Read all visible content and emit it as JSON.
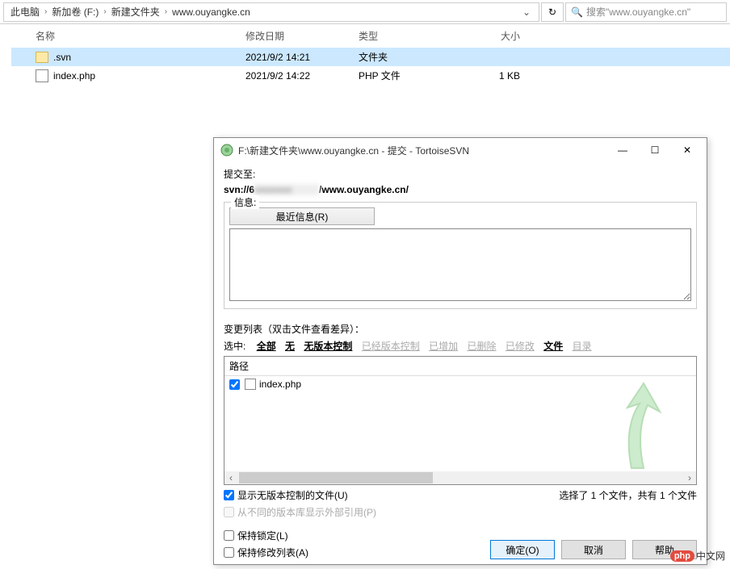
{
  "explorer": {
    "breadcrumb": [
      "此电脑",
      "新加卷 (F:)",
      "新建文件夹",
      "www.ouyangke.cn"
    ],
    "search_placeholder": "搜索\"www.ouyangke.cn\"",
    "columns": {
      "name": "名称",
      "date": "修改日期",
      "type": "类型",
      "size": "大小"
    },
    "rows": [
      {
        "name": ".svn",
        "date": "2021/9/2 14:21",
        "type": "文件夹",
        "size": "",
        "icon": "folder",
        "selected": true
      },
      {
        "name": "index.php",
        "date": "2021/9/2 14:22",
        "type": "PHP 文件",
        "size": "1 KB",
        "icon": "php",
        "selected": false
      }
    ]
  },
  "dialog": {
    "title": "F:\\新建文件夹\\www.ouyangke.cn - 提交 - TortoiseSVN",
    "commit_to_label": "提交至:",
    "url_prefix": "svn://6",
    "url_suffix": "/www.ouyangke.cn/",
    "info_label": "信息:",
    "recent_btn": "最近信息(R)",
    "changes_label": "变更列表（双击文件查看差异）：",
    "filter_label": "选中:",
    "filters": {
      "all": "全部",
      "none": "无",
      "unversioned": "无版本控制",
      "versioned": "已经版本控制",
      "added": "已增加",
      "deleted": "已删除",
      "modified": "已修改",
      "files": "文件",
      "dirs": "目录"
    },
    "list_header": "路径",
    "list_items": [
      {
        "checked": true,
        "name": "index.php"
      }
    ],
    "show_unversioned": "显示无版本控制的文件(U)",
    "show_externals": "从不同的版本库显示外部引用(P)",
    "selection_status": "选择了 1 个文件，共有 1 个文件",
    "keep_locks": "保持锁定(L)",
    "keep_changelist": "保持修改列表(A)",
    "ok_btn": "确定(O)",
    "cancel_btn": "取消",
    "help_btn": "帮助"
  },
  "watermark": {
    "badge": "php",
    "text": "中文网"
  }
}
